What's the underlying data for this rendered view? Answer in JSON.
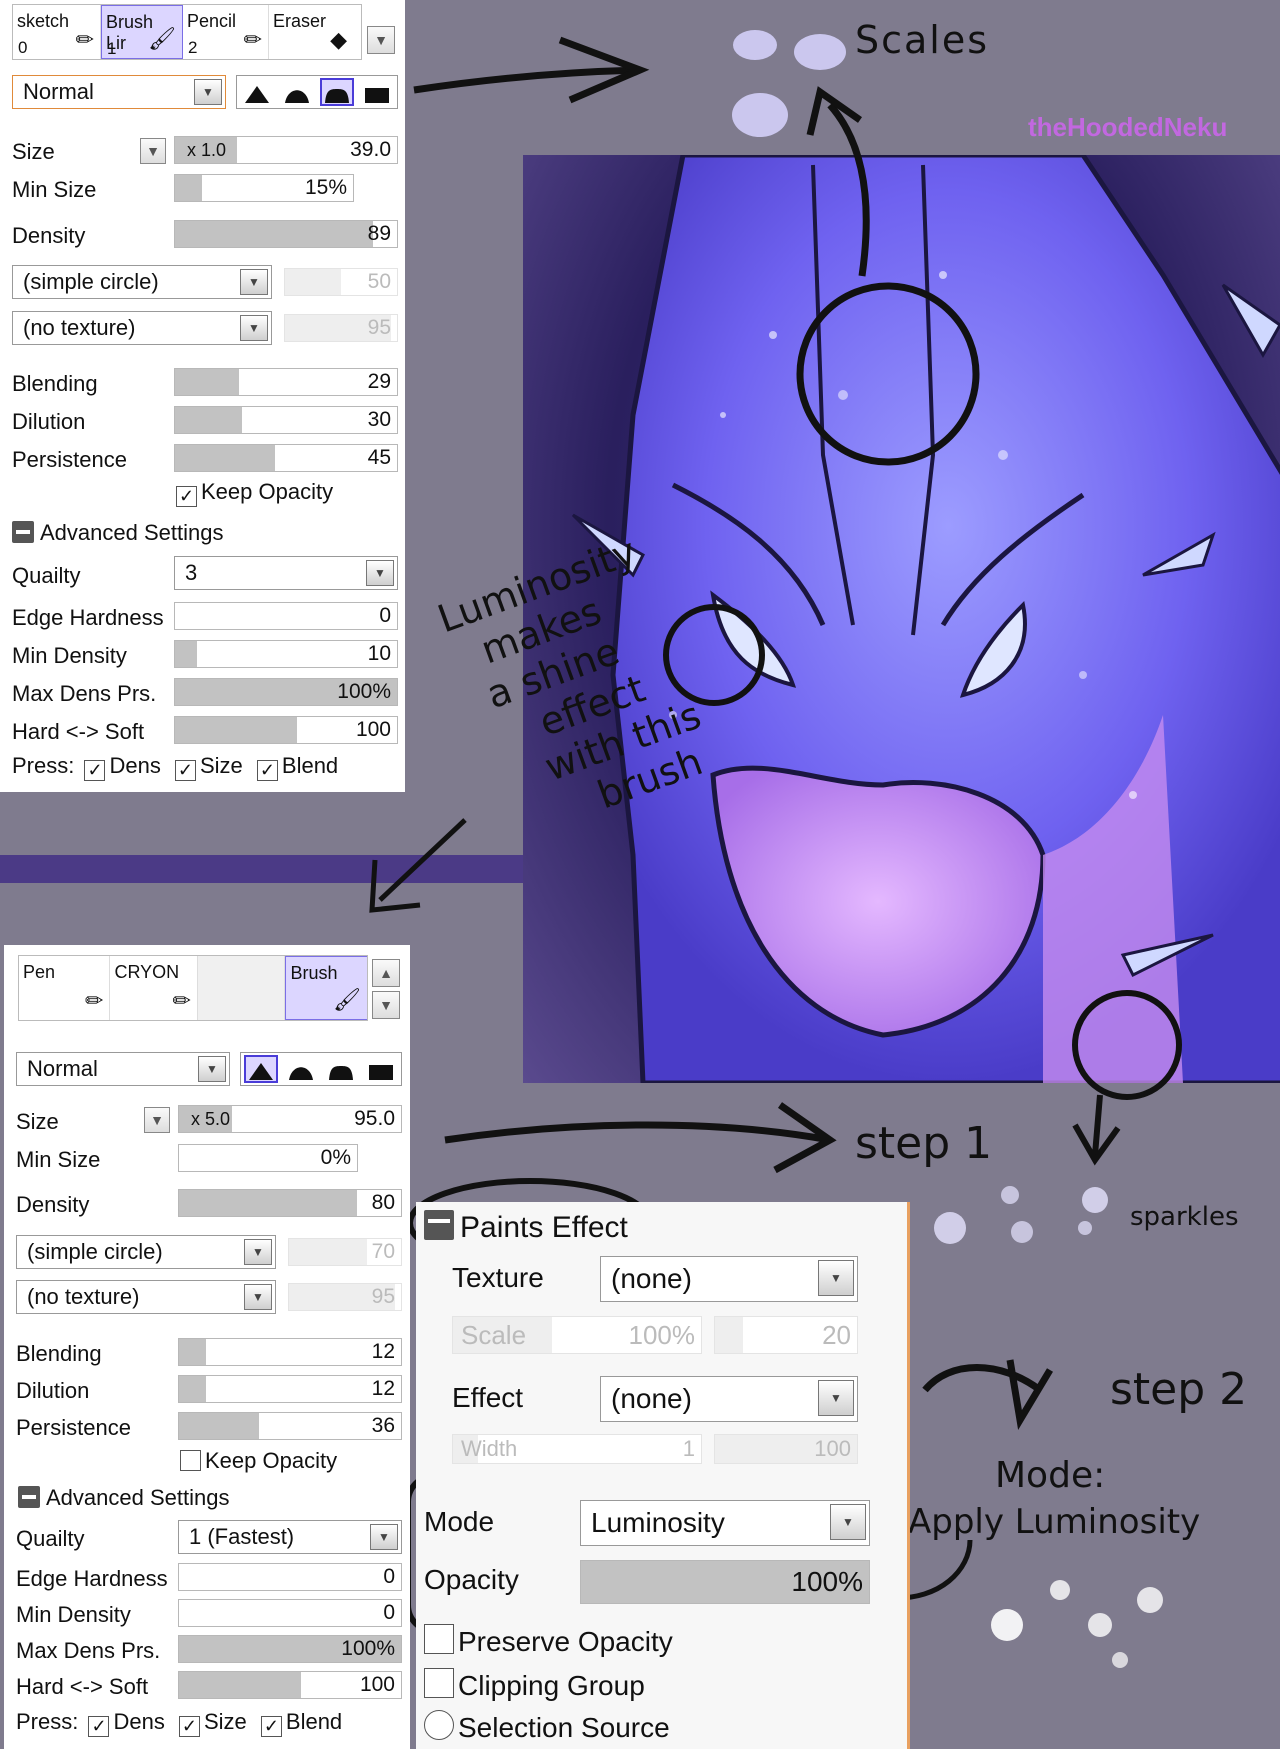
{
  "panel1": {
    "tools": [
      {
        "name": "sketch",
        "num": "0"
      },
      {
        "name": "Brush Lir",
        "num": "1"
      },
      {
        "name": "Pencil",
        "num": "2"
      },
      {
        "name": "Eraser",
        "num": ""
      }
    ],
    "blend_mode": "Normal",
    "size_label": "Size",
    "size_mult": "x 1.0",
    "size_value": "39.0",
    "min_size_label": "Min Size",
    "min_size_value": "15%",
    "density_label": "Density",
    "density_value": "89",
    "shape": "(simple circle)",
    "shape_value": "50",
    "texture": "(no texture)",
    "texture_value": "95",
    "blending_label": "Blending",
    "blending_value": "29",
    "dilution_label": "Dilution",
    "dilution_value": "30",
    "persistence_label": "Persistence",
    "persistence_value": "45",
    "keep_opacity": "Keep Opacity",
    "advanced": "Advanced Settings",
    "quality_label": "Quailty",
    "quality_value": "3",
    "edge_label": "Edge Hardness",
    "edge_value": "0",
    "min_density_label": "Min Density",
    "min_density_value": "10",
    "max_dens_label": "Max Dens Prs.",
    "max_dens_value": "100%",
    "hard_soft_label": "Hard <-> Soft",
    "hard_soft_value": "100",
    "press_label": "Press:",
    "dens": "Dens",
    "size": "Size",
    "blend": "Blend"
  },
  "panel2": {
    "tools": [
      {
        "name": "Pen"
      },
      {
        "name": "CRYON"
      },
      {
        "name": ""
      },
      {
        "name": "Brush"
      }
    ],
    "blend_mode": "Normal",
    "size_label": "Size",
    "size_mult": "x 5.0",
    "size_value": "95.0",
    "min_size_label": "Min Size",
    "min_size_value": "0%",
    "density_label": "Density",
    "density_value": "80",
    "shape": "(simple circle)",
    "shape_value": "70",
    "texture": "(no texture)",
    "texture_value": "95",
    "blending_label": "Blending",
    "blending_value": "12",
    "dilution_label": "Dilution",
    "dilution_value": "12",
    "persistence_label": "Persistence",
    "persistence_value": "36",
    "keep_opacity": "Keep Opacity",
    "advanced": "Advanced Settings",
    "quality_label": "Quailty",
    "quality_value": "1 (Fastest)",
    "edge_label": "Edge Hardness",
    "edge_value": "0",
    "min_density_label": "Min Density",
    "min_density_value": "0",
    "max_dens_label": "Max Dens Prs.",
    "max_dens_value": "100%",
    "hard_soft_label": "Hard <-> Soft",
    "hard_soft_value": "100",
    "press_label": "Press:",
    "dens": "Dens",
    "size": "Size",
    "blend": "Blend"
  },
  "paints": {
    "title": "Paints Effect",
    "texture_label": "Texture",
    "texture_value": "(none)",
    "scale_label": "Scale",
    "scale_value": "100%",
    "scale_num": "20",
    "effect_label": "Effect",
    "effect_value": "(none)",
    "width_label": "Width",
    "width_value": "1",
    "width_num": "100",
    "mode_label": "Mode",
    "mode_value": "Luminosity",
    "opacity_label": "Opacity",
    "opacity_value": "100%",
    "preserve": "Preserve Opacity",
    "clipping": "Clipping Group",
    "selection": "Selection Source"
  },
  "annotations": {
    "scales": "Scales",
    "watermark": "theHoodedNeku",
    "luminosity_note": [
      "Luminosity",
      "makes",
      "a shine",
      "effect",
      "with this",
      "brush"
    ],
    "step1": "step 1",
    "sparkles": "sparkles",
    "step2": "step 2",
    "mode_note1": "Mode:",
    "mode_note2": "Apply Luminosity"
  },
  "colors": {
    "background": "#7f7b8e",
    "accent": "#dcd6ff",
    "divider": "#4b3a86",
    "watermark": "#c268e0"
  }
}
